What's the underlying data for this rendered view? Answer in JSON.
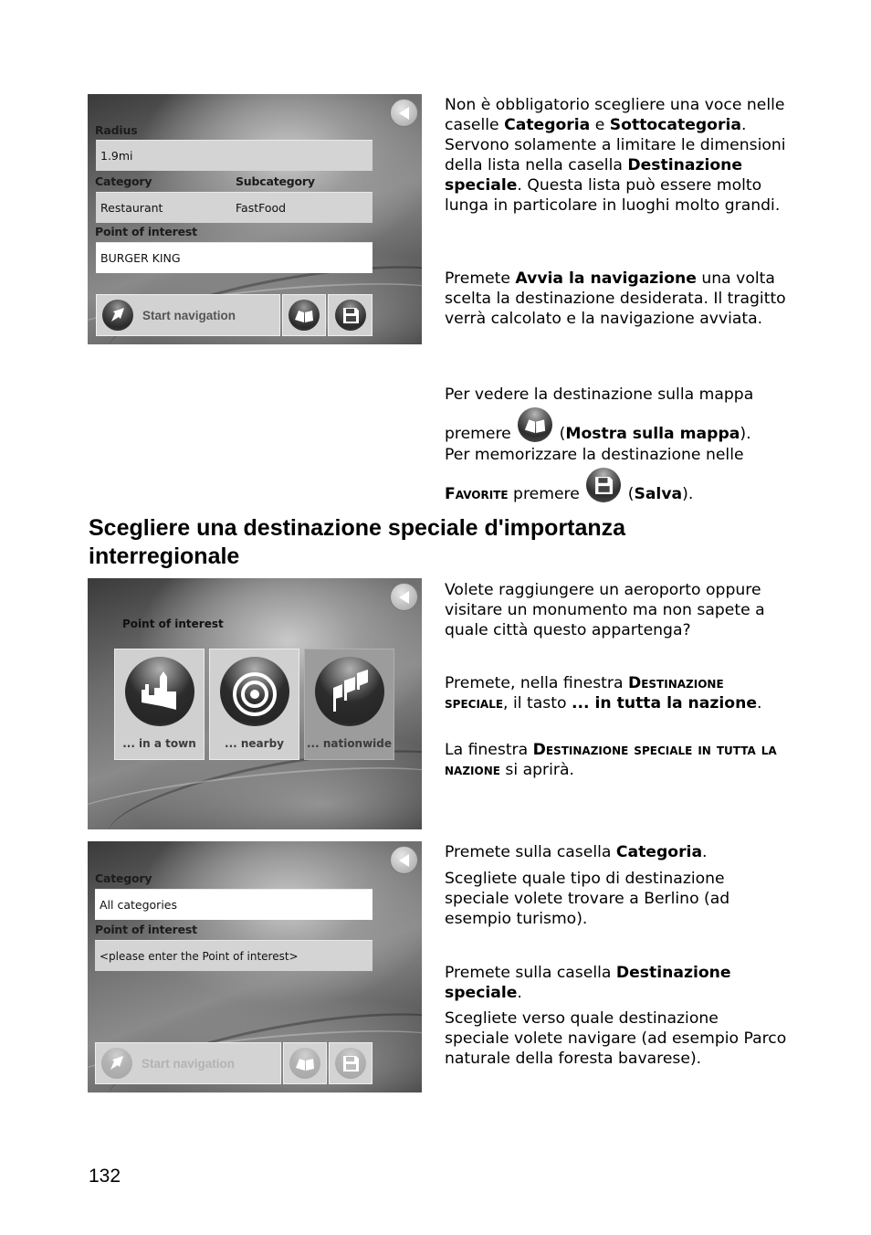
{
  "section1": {
    "screen": {
      "radius_label": "Radius",
      "radius_value": "1.9mi",
      "category_label": "Category",
      "subcategory_label": "Subcategory",
      "category_value": "Restaurant",
      "subcategory_value": "FastFood",
      "poi_label": "Point of interest",
      "poi_value": "BURGER KING",
      "start_navigation": "Start navigation"
    },
    "p1": {
      "t1": "Non è obbligatorio scegliere una voce nelle caselle ",
      "b1": "Categoria",
      "t2": " e ",
      "b2": "Sottocategoria",
      "t3": ". Servono solamente a limitare le dimensioni della lista nella casella ",
      "b3": "Destinazione speciale",
      "t4": ". Questa lista può essere molto lunga in particolare in luoghi molto grandi."
    },
    "p2": {
      "t1": "Premete ",
      "b1": "Avvia la navigazione",
      "t2": " una volta scelta la destinazione desiderata. Il tragitto verrà calcolato e la navigazione avviata."
    },
    "p3": {
      "t1": "Per vedere la destinazione sulla mappa premere ",
      "t2": " (",
      "b1": "Mostra sulla mappa",
      "t3": ")."
    },
    "p4": {
      "t1": "Per memorizzare la destinazione nelle ",
      "sc1": "Favorite",
      "t2": " premere ",
      "t3": " (",
      "b1": "Salva",
      "t4": ")."
    }
  },
  "heading": "Scegliere una destinazione speciale d'importanza interregionale",
  "section2": {
    "screen": {
      "title": "Point of interest",
      "tiles": [
        {
          "label": "... in a town",
          "icon": "city-icon"
        },
        {
          "label": "... nearby",
          "icon": "target-icon"
        },
        {
          "label": "... nationwide",
          "icon": "flags-icon",
          "selected": true
        }
      ]
    },
    "p1": "Volete raggiungere un aeroporto oppure visitare un monumento ma non sapete a quale città questo appartenga?",
    "p2": {
      "t1": "Premete, nella finestra ",
      "sc1": "Destinazione speciale",
      "t2": ", il tasto ",
      "b1": "... in tutta la nazione",
      "t3": "."
    },
    "p3": {
      "t1": "La finestra ",
      "sc1": "Destinazione speciale in tutta la nazione",
      "t2": " si aprirà."
    }
  },
  "section3": {
    "screen": {
      "category_label": "Category",
      "category_value": "All categories",
      "poi_label": "Point of interest",
      "poi_placeholder": "<please enter the Point of interest>",
      "start_navigation": "Start navigation"
    },
    "p1": {
      "t1": "Premete sulla casella ",
      "b1": "Categoria",
      "t2": "."
    },
    "p2": "Scegliete quale tipo di destinazione speciale volete trovare a Berlino (ad esempio turismo).",
    "p3": {
      "t1": "Premete sulla casella ",
      "b1": "Destinazione speciale",
      "t2": "."
    },
    "p4": "Scegliete verso quale destinazione speciale volete navigare (ad esempio Parco naturale della foresta bavarese)."
  },
  "page_number": "132"
}
